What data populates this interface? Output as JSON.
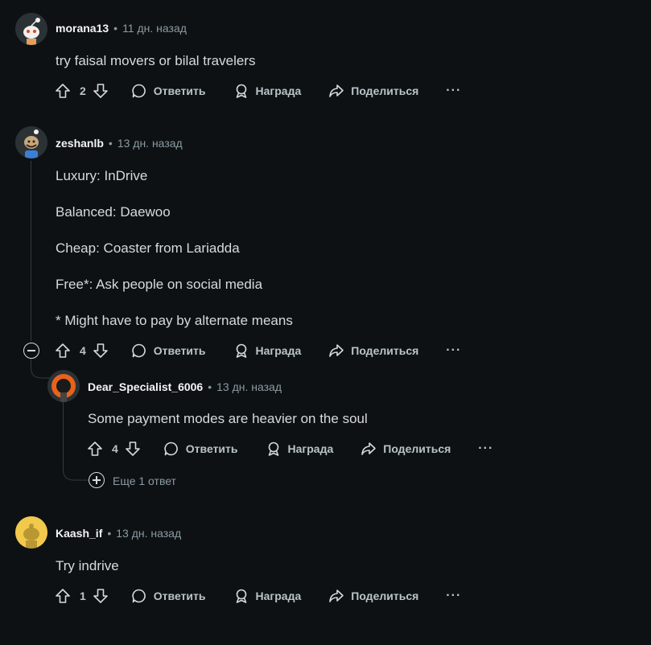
{
  "comments": [
    {
      "author": "morana13",
      "time": "11 дн. назад",
      "lines": [
        "try faisal movers or bilal travelers"
      ],
      "votes": "2",
      "reply_label": "Ответить",
      "award_label": "Награда",
      "share_label": "Поделиться",
      "more_label": "···"
    },
    {
      "author": "zeshanlb",
      "time": "13 дн. назад",
      "lines": [
        "Luxury: InDrive",
        "Balanced: Daewoo",
        "Cheap: Coaster from Lariadda",
        "Free*: Ask people on social media",
        "* Might have to pay by alternate means"
      ],
      "votes": "4",
      "reply_label": "Ответить",
      "award_label": "Награда",
      "share_label": "Поделиться",
      "more_label": "···"
    },
    {
      "author": "Dear_Specialist_6006",
      "time": "13 дн. назад",
      "lines": [
        "Some payment modes are heavier on the soul"
      ],
      "votes": "4",
      "reply_label": "Ответить",
      "award_label": "Награда",
      "share_label": "Поделиться",
      "more_label": "···"
    },
    {
      "author": "Kaash_if",
      "time": "13 дн. назад",
      "lines": [
        "Try indrive"
      ],
      "votes": "1",
      "reply_label": "Ответить",
      "award_label": "Награда",
      "share_label": "Поделиться",
      "more_label": "···"
    }
  ],
  "more_replies_label": "Еще 1 ответ",
  "separator": "•",
  "colors": {
    "background": "#0e1113",
    "text": "#d7dadc",
    "meta": "#8a9ba4",
    "thread_line": "#33393c"
  }
}
